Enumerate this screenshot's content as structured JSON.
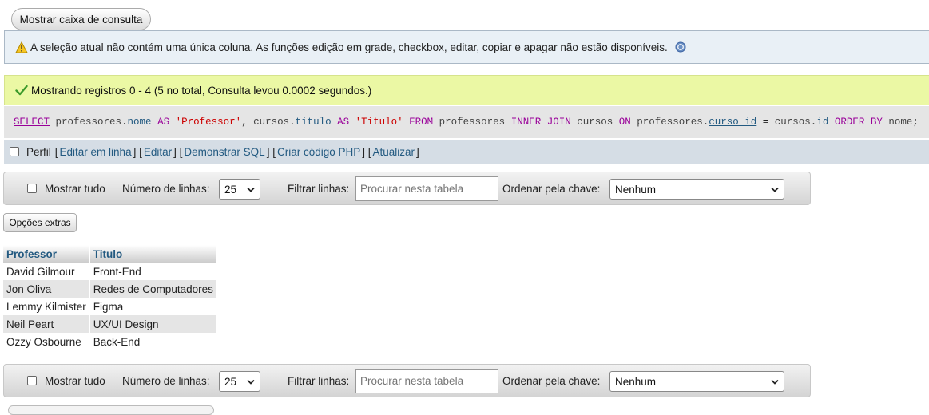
{
  "show_query_box_label": "Mostrar caixa de consulta",
  "notice": {
    "text": "A seleção atual não contém uma única coluna. As funções edição em grade, checkbox, editar, copiar e apagar não estão disponíveis."
  },
  "success": {
    "text": "Mostrando registros 0 - 4 (5 no total, Consulta levou 0.0002 segundos.)"
  },
  "sql": {
    "t1": "SELECT",
    "t2": " professores.",
    "t3": "nome",
    "t4": " AS ",
    "t5": "'Professor'",
    "t6": ", cursos.",
    "t7": "titulo",
    "t8": " AS ",
    "t9": "'Titulo'",
    "t10": " FROM ",
    "t11": "professores ",
    "t12": "INNER JOIN",
    "t13": " cursos ",
    "t14": "ON",
    "t15": " professores.",
    "t16": "curso_id",
    "t17": " = ",
    "t18": "cursos.",
    "t19": "id",
    "t20": " ORDER BY",
    "t21": " nome;"
  },
  "tools": {
    "profile": "Perfil",
    "b1": "[",
    "edit_inline": "Editar em linha",
    "b2": "] [",
    "edit": "Editar",
    "b3": "] [",
    "explain": "Demonstrar SQL",
    "b4": "] [",
    "php": "Criar código PHP",
    "b5": "] [",
    "refresh": "Atualizar",
    "b6": "]"
  },
  "nav": {
    "show_all": "Mostrar tudo",
    "rows_label": "Número de linhas:",
    "rows_value": "25",
    "filter_label": "Filtrar linhas:",
    "filter_placeholder": "Procurar nesta tabela",
    "sort_label": "Ordenar pela chave:",
    "sort_value": "Nenhum"
  },
  "extra_options_label": "Opções extras",
  "table": {
    "headers": [
      "Professor",
      "Titulo"
    ],
    "rows": [
      [
        "David Gilmour",
        "Front-End"
      ],
      [
        "Jon Oliva",
        "Redes de Computadores"
      ],
      [
        "Lemmy Kilmister",
        "Figma"
      ],
      [
        "Neil Peart",
        "UX/UI Design"
      ],
      [
        "Ozzy Osbourne",
        "Back-End"
      ]
    ]
  },
  "colors": {
    "link": "#235a81",
    "success_bg": "#ebf8a4",
    "notice_bg": "#e9f0f6",
    "sql_keyword": "#990099",
    "sql_string": "#cc0000"
  },
  "icons": {
    "warning": "warning-icon",
    "help": "help-icon",
    "success": "check-icon",
    "dropdown": "chevron-down-icon"
  }
}
